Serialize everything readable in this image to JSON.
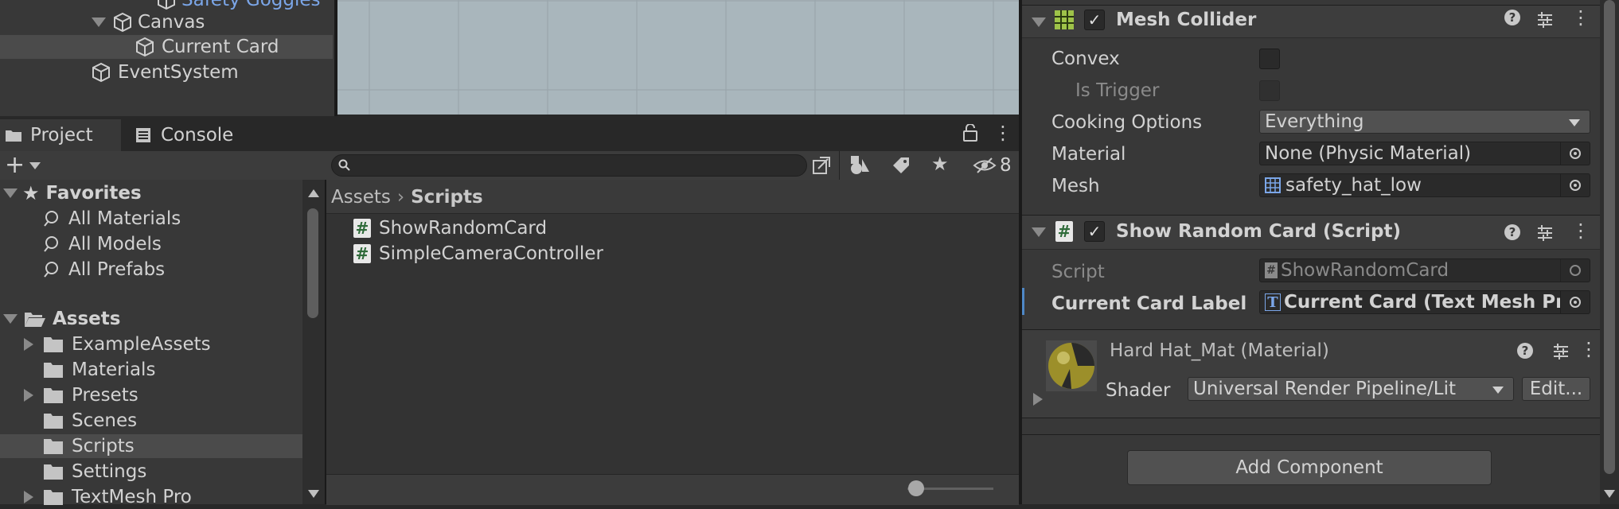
{
  "hierarchy": {
    "items": [
      {
        "label": "Safety Goggles"
      },
      {
        "label": "Canvas"
      },
      {
        "label": "Current Card"
      },
      {
        "label": "EventSystem"
      }
    ]
  },
  "project_panel": {
    "tabs": [
      {
        "label": "Project"
      },
      {
        "label": "Console"
      }
    ],
    "hidden_count": "8",
    "search": {
      "value": "",
      "placeholder": ""
    },
    "favorites": {
      "label": "Favorites",
      "items": [
        {
          "label": "All Materials"
        },
        {
          "label": "All Models"
        },
        {
          "label": "All Prefabs"
        }
      ]
    },
    "assets": {
      "label": "Assets",
      "folders": [
        {
          "label": "ExampleAssets"
        },
        {
          "label": "Materials"
        },
        {
          "label": "Presets"
        },
        {
          "label": "Scenes"
        },
        {
          "label": "Scripts"
        },
        {
          "label": "Settings"
        },
        {
          "label": "TextMesh Pro"
        }
      ]
    },
    "breadcrumb": {
      "root": "Assets",
      "current": "Scripts"
    },
    "files": [
      {
        "label": "ShowRandomCard"
      },
      {
        "label": "SimpleCameraController"
      }
    ],
    "zoom_level": 0.1
  },
  "inspector": {
    "mesh_collider": {
      "title": "Mesh Collider",
      "convex_label": "Convex",
      "is_trigger_label": "Is Trigger",
      "cooking_options_label": "Cooking Options",
      "cooking_options_value": "Everything",
      "material_label": "Material",
      "material_value": "None (Physic Material)",
      "mesh_label": "Mesh",
      "mesh_value": "safety_hat_low"
    },
    "script_component": {
      "title": "Show Random Card (Script)",
      "script_label": "Script",
      "script_value": "ShowRandomCard",
      "current_card_label": "Current Card Label",
      "current_card_value": "Current Card (Text Mesh Pro"
    },
    "material": {
      "title": "Hard Hat_Mat (Material)",
      "shader_label": "Shader",
      "shader_value": "Universal Render Pipeline/Lit",
      "edit_label": "Edit..."
    },
    "add_component_label": "Add Component"
  },
  "colors": {
    "selection": "#3e3e3e",
    "panel": "#383838",
    "scene": "#a9b6bc",
    "link": "#7ba6e8",
    "accent": "#4e88c7"
  }
}
